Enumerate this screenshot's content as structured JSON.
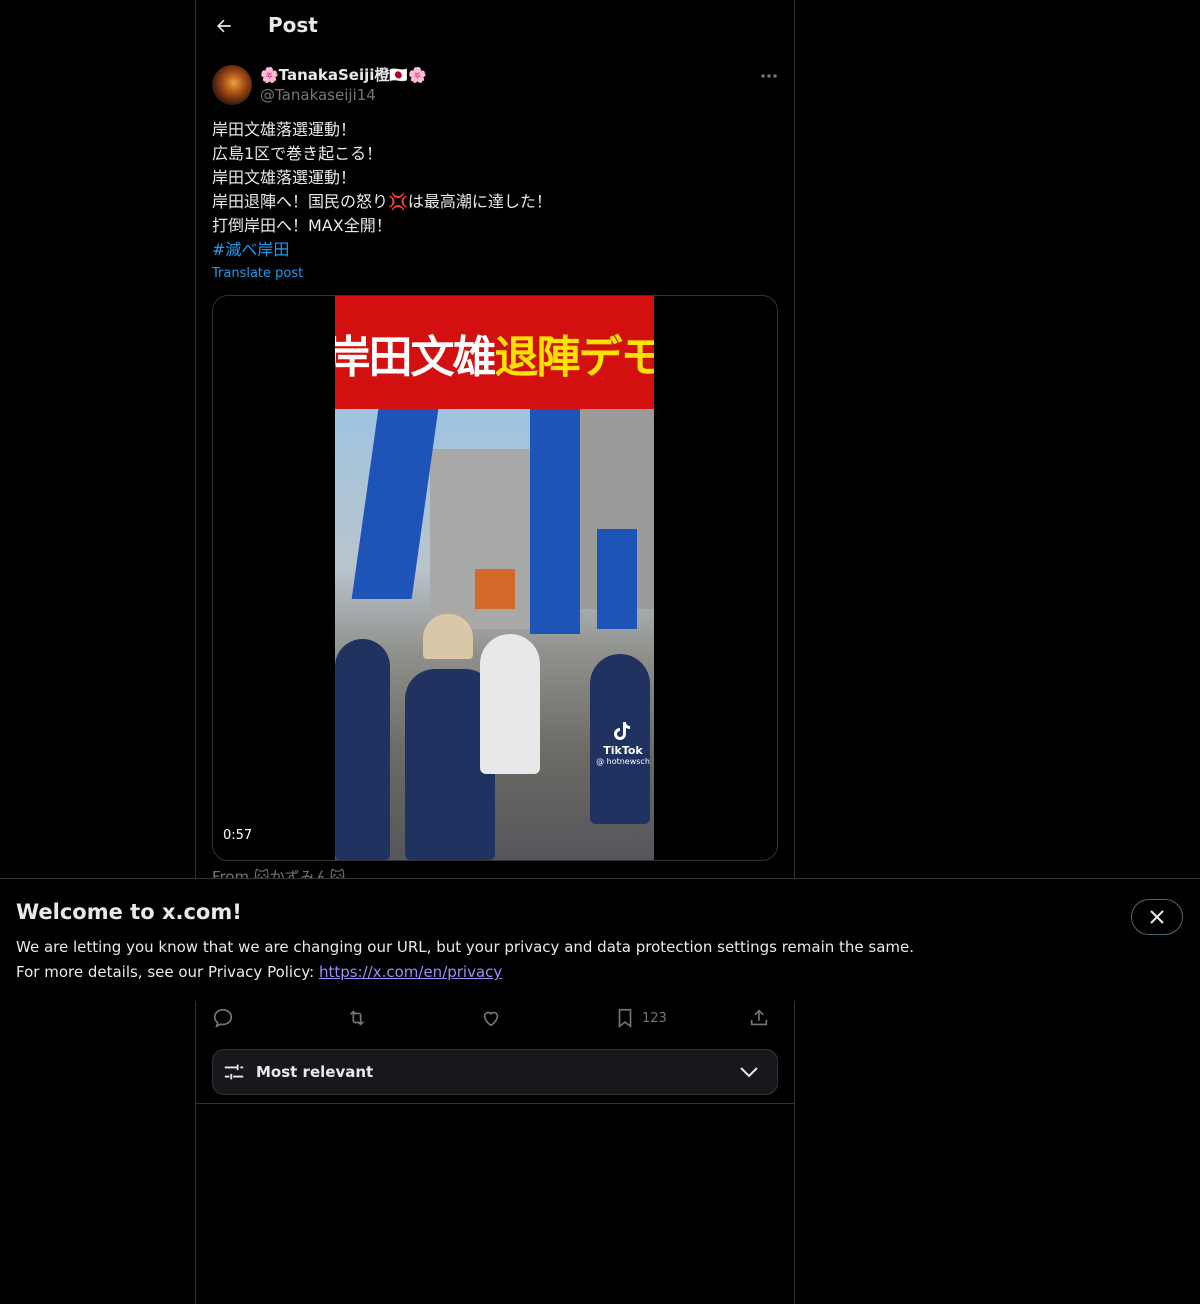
{
  "header": {
    "title": "Post"
  },
  "author": {
    "display_name": "🌸TanakaSeiji橙🇯🇵🌸",
    "handle": "@Tanakaseiji14"
  },
  "tweet": {
    "lines": [
      "岸田文雄落選運動！",
      "広島1区で巻き起こる！",
      "岸田文雄落選運動！",
      "岸田退陣へ！国民の怒り💢は最高潮に達した！",
      "打倒岸田へ！MAX全開！"
    ],
    "hashtag": "#滅べ岸田",
    "translate_label": "Translate post"
  },
  "media": {
    "banner_white": "岸田文雄",
    "banner_yellow": "退陣デモ",
    "watermark_brand": "TikTok",
    "watermark_handle": "@ hotnewsch",
    "duration": "0:57"
  },
  "from_line": "From 🐱かずみん🐱",
  "actions": {
    "bookmark_count": "123"
  },
  "sort": {
    "label": "Most relevant"
  },
  "welcome": {
    "title": "Welcome to x.com!",
    "line1": "We are letting you know that we are changing our URL, but your privacy and data protection settings remain the same.",
    "line2_prefix": "For more details, see our Privacy Policy: ",
    "link": "https://x.com/en/privacy"
  },
  "colors": {
    "background": "#000000",
    "accent": "#1d9bf0",
    "link_purple": "#9c8cf9",
    "muted": "#71767b",
    "banner_red": "#d21010",
    "banner_yellow": "#ffe300"
  },
  "icons": [
    "back-arrow-icon",
    "more-icon",
    "reply-icon",
    "repost-icon",
    "like-icon",
    "bookmark-icon",
    "share-icon",
    "sort-settings-icon",
    "chevron-down-icon",
    "close-icon",
    "tiktok-icon"
  ]
}
